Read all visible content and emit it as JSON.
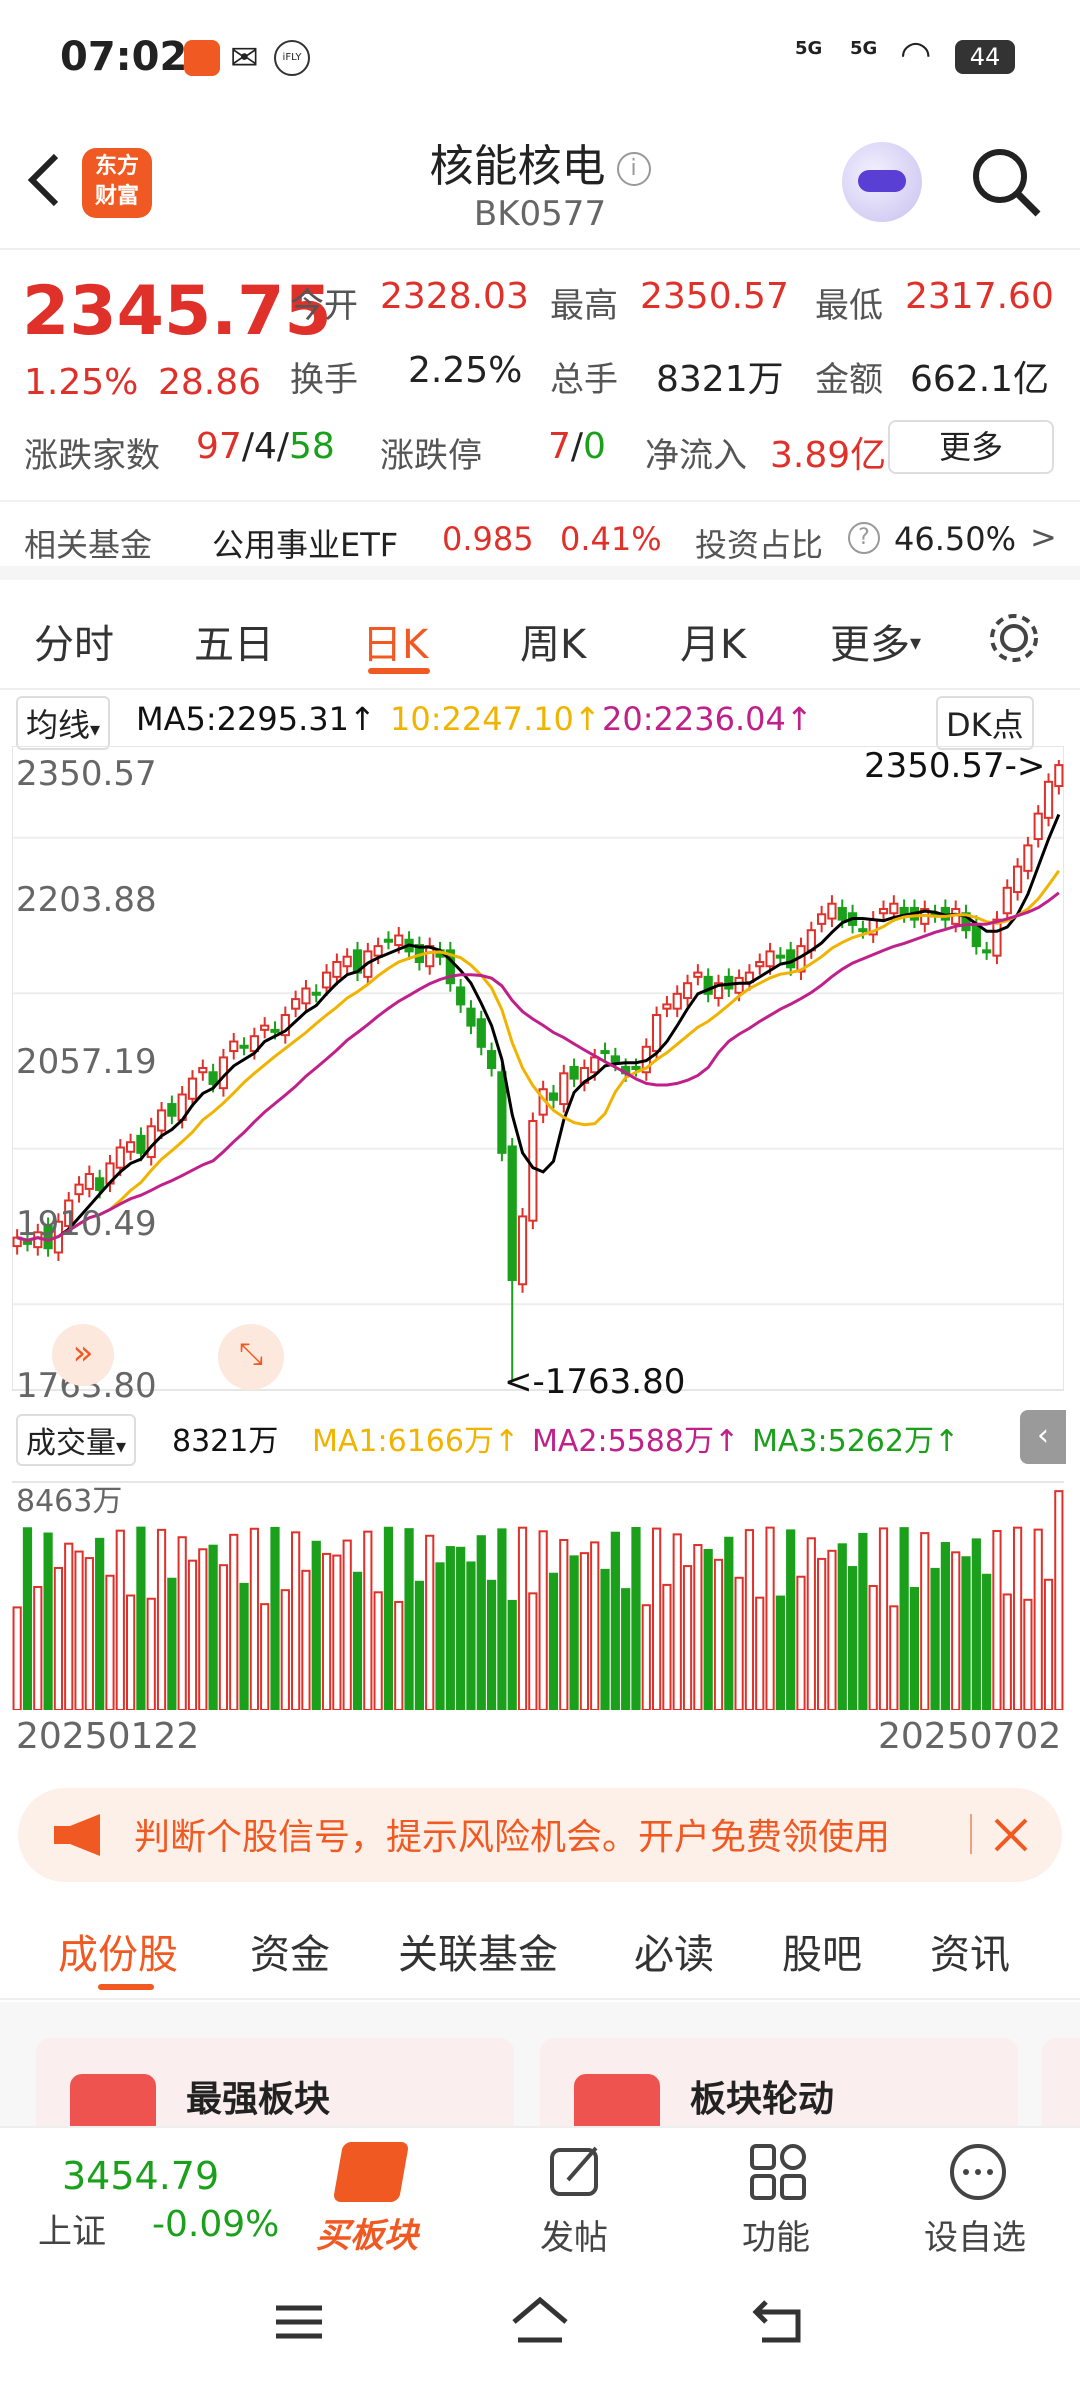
{
  "status_bar": {
    "time": "07:02",
    "signal1": "5G",
    "signal2": "5G",
    "battery": "44",
    "app_icon_label": "iFLY"
  },
  "header": {
    "logo_text": "东方\n财富",
    "title": "核能核电",
    "code": "BK0577"
  },
  "quote": {
    "price": "2345.75",
    "change_pct": "1.25%",
    "change_val": "28.86",
    "open_label": "今开",
    "open": "2328.03",
    "high_label": "最高",
    "high": "2350.57",
    "low_label": "最低",
    "low": "2317.60",
    "turnover_label": "换手",
    "turnover": "2.25%",
    "volume_label": "总手",
    "volume": "8321万",
    "amount_label": "金额",
    "amount": "662.1亿",
    "updown_label": "涨跌家数",
    "up": "97",
    "flat": "4",
    "down": "58",
    "limit_label": "涨跌停",
    "limit_up": "7",
    "limit_down": "0",
    "netflow_label": "净流入",
    "netflow": "3.89亿",
    "more_label": "更多"
  },
  "fund_row": {
    "label": "相关基金",
    "fund_name": "公用事业ETF",
    "price": "0.985",
    "pct": "0.41%",
    "ratio_label": "投资占比",
    "ratio": "46.50%"
  },
  "period_tabs": {
    "items": [
      "分时",
      "五日",
      "日K",
      "周K",
      "月K",
      "更多"
    ],
    "active": "日K"
  },
  "ma_bar": {
    "selector": "均线",
    "ma5": "MA5:2295.31",
    "ma10": "10:2247.10",
    "ma20": "20:2236.04",
    "dk": "DK点"
  },
  "chart_data": {
    "type": "candlestick",
    "y_ticks": [
      "2350.57",
      "2203.88",
      "2057.19",
      "1910.49",
      "1763.80"
    ],
    "ylim": [
      1763.8,
      2350.57
    ],
    "max_annotation": "2350.57->",
    "min_annotation": "<-1763.80",
    "start_date": "20250122",
    "end_date": "20250702",
    "closes": [
      1900,
      1895,
      1905,
      1890,
      1915,
      1935,
      1950,
      1960,
      1945,
      1970,
      1985,
      1990,
      1980,
      2005,
      2020,
      2015,
      2035,
      2050,
      2060,
      2045,
      2070,
      2085,
      2080,
      2090,
      2100,
      2095,
      2110,
      2125,
      2135,
      2130,
      2150,
      2160,
      2165,
      2150,
      2170,
      2175,
      2180,
      2185,
      2170,
      2160,
      2175,
      2165,
      2140,
      2120,
      2100,
      2080,
      2060,
      1980,
      1860,
      1920,
      2010,
      2040,
      2030,
      2055,
      2050,
      2060,
      2070,
      2075,
      2065,
      2055,
      2060,
      2080,
      2110,
      2120,
      2130,
      2140,
      2150,
      2130,
      2140,
      2135,
      2145,
      2150,
      2160,
      2170,
      2165,
      2155,
      2175,
      2190,
      2205,
      2215,
      2200,
      2195,
      2190,
      2200,
      2210,
      2215,
      2205,
      2200,
      2210,
      2205,
      2200,
      2210,
      2190,
      2175,
      2170,
      2200,
      2230,
      2250,
      2270,
      2300,
      2330,
      2345.75
    ],
    "volume_selector": "成交量",
    "volume_today": "8321万",
    "vol_ma1": "MA1:6166万",
    "vol_ma2": "MA2:5588万",
    "vol_ma3": "MA3:5262万",
    "volume_ymax_label": "8463万"
  },
  "banner": {
    "text": "判断个股信号，提示风险机会。开户免费领使用"
  },
  "section_tabs": {
    "items": [
      "成份股",
      "资金",
      "关联基金",
      "必读",
      "股吧",
      "资讯"
    ],
    "active": "成份股"
  },
  "cards": [
    {
      "title": "最强板块"
    },
    {
      "title": "板块轮动"
    }
  ],
  "bottom_nav": {
    "index_value": "3454.79",
    "index_name": "上证",
    "index_change": "-0.09%",
    "buy_label": "买板块",
    "post_label": "发帖",
    "func_label": "功能",
    "watch_label": "设自选"
  },
  "colors": {
    "up": "#e0302a",
    "down": "#1aa01a",
    "accent": "#f05a22",
    "ma5": "#000000",
    "ma10": "#f0b400",
    "ma20": "#c0208a"
  }
}
